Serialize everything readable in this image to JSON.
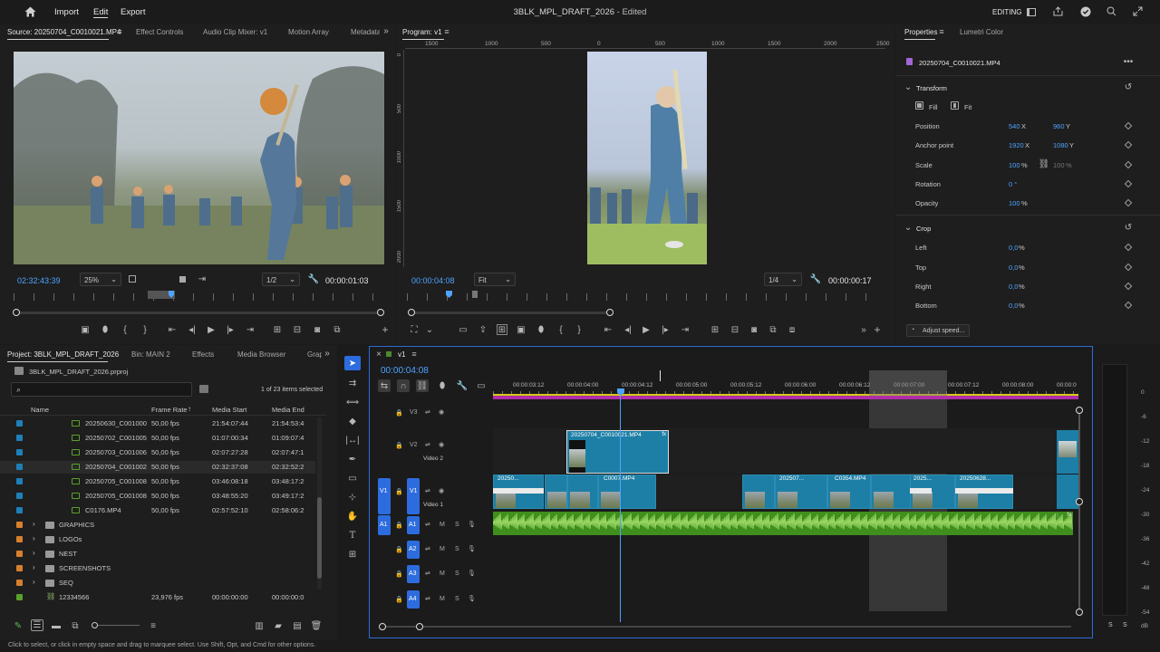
{
  "menubar": {
    "import": "Import",
    "edit": "Edit",
    "export": "Export",
    "title": "3BLK_MPL_DRAFT_2026",
    "title_suffix": "- Edited",
    "workspace": "EDITING"
  },
  "source_monitor": {
    "tabs": [
      "Source: 20250704_C0010021.MP4",
      "Effect Controls",
      "Audio Clip Mixer: v1",
      "Motion Array",
      "Metadata"
    ],
    "timecode": "02:32:43:39",
    "zoom": "25%",
    "resolution": "1/2",
    "duration": "00:00:01:03"
  },
  "program_monitor": {
    "tab": "Program: v1",
    "ruler_labels": [
      "1500",
      "1000",
      "500",
      "0",
      "500",
      "1000",
      "1500",
      "2000",
      "2500"
    ],
    "left_ruler_labels": [
      "0",
      "500",
      "1000",
      "1500",
      "2000"
    ],
    "timecode": "00:00:04:08",
    "fit": "Fit",
    "resolution": "1/4",
    "duration": "00:00:00:17"
  },
  "properties": {
    "tabs": [
      "Properties",
      "Lumetri Color"
    ],
    "clip_name": "20250704_C0010021.MP4",
    "transform_header": "Transform",
    "fill": "Fill",
    "fit": "Fit",
    "position_label": "Position",
    "position_x": "540",
    "position_y": "960",
    "anchor_label": "Anchor point",
    "anchor_x": "1920",
    "anchor_y": "1080",
    "scale_label": "Scale",
    "scale_value": "100",
    "scale_value2": "100",
    "rotation_label": "Rotation",
    "rotation_value": "0 °",
    "opacity_label": "Opacity",
    "opacity_value": "100",
    "crop_header": "Crop",
    "left_label": "Left",
    "left_value": "0,0",
    "top_label": "Top",
    "top_value": "0,0",
    "right_label": "Right",
    "right_value": "0,0",
    "bottom_label": "Bottom",
    "bottom_value": "0,0",
    "unit_x": "X",
    "unit_y": "Y",
    "unit_pct": "%",
    "adjust_speed": "Adjust speed..."
  },
  "project": {
    "tabs": [
      "Project: 3BLK_MPL_DRAFT_2026",
      "Bin: MAIN 2",
      "Effects",
      "Media Browser",
      "Grap"
    ],
    "file": "3BLK_MPL_DRAFT_2026.prproj",
    "selection": "1 of 23 items selected",
    "columns": [
      "Name",
      "Frame Rate",
      "Media Start",
      "Media End"
    ],
    "items": [
      {
        "name": "20250630_C001000",
        "rate": "50,00 fps",
        "start": "21:54:07:44",
        "end": "21:54:53:4",
        "color": "#1f7fb8"
      },
      {
        "name": "20250702_C001005",
        "rate": "50,00 fps",
        "start": "01:07:00:34",
        "end": "01:09:07:4",
        "color": "#1f7fb8"
      },
      {
        "name": "20250703_C001006",
        "rate": "50,00 fps",
        "start": "02:07:27:28",
        "end": "02:07:47:1",
        "color": "#1f7fb8"
      },
      {
        "name": "20250704_C001002",
        "rate": "50,00 fps",
        "start": "02:32:37:08",
        "end": "02:32:52:2",
        "color": "#1f7fb8"
      },
      {
        "name": "20250705_C001008",
        "rate": "50,00 fps",
        "start": "03:46:08:18",
        "end": "03:48:17:2",
        "color": "#1f7fb8"
      },
      {
        "name": "20250705_C001008",
        "rate": "50,00 fps",
        "start": "03:48:55:20",
        "end": "03:49:17:2",
        "color": "#1f7fb8"
      },
      {
        "name": "C0176.MP4",
        "rate": "50,00 fps",
        "start": "02:57:52:10",
        "end": "02:58:06:2",
        "color": "#1f7fb8"
      }
    ],
    "folders": [
      {
        "name": "GRAPHICS",
        "color": "#d6802e"
      },
      {
        "name": "LOGOs",
        "color": "#d6802e"
      },
      {
        "name": "NEST",
        "color": "#d6802e"
      },
      {
        "name": "SCREENSHOTS",
        "color": "#d6802e"
      },
      {
        "name": "SEQ",
        "color": "#d6802e"
      }
    ],
    "sequence": {
      "name": "12334566",
      "rate": "23,976 fps",
      "start": "00:00:00:00",
      "end": "00:00:00:0",
      "color": "#5aa02c"
    }
  },
  "timeline": {
    "tab": "v1",
    "timecode": "00:00:04:08",
    "ruler": [
      "00:00:03:12",
      "00:00:04:00",
      "00:00:04:12",
      "00:00:05:00",
      "00:00:05:12",
      "00:00:06:00",
      "00:00:06:12",
      "00:00:07:00",
      "00:00:07:12",
      "00:00:08:00",
      "00:00:0"
    ],
    "tracks_video": [
      {
        "id": "V3",
        "name": ""
      },
      {
        "id": "V2",
        "name": "Video 2"
      },
      {
        "id": "V1",
        "name": "Video 1"
      }
    ],
    "tracks_audio": [
      "A1",
      "A2",
      "A3",
      "A4"
    ],
    "track_m": "M",
    "track_s": "S",
    "v1_source": "V1",
    "a1_source": "A1",
    "v2_clip": "20250704_C0010021.MP4",
    "v1_clips": [
      "20250...",
      "C0007.MP4",
      "202507...",
      "C0354.MP4",
      "2025...",
      "20250628..."
    ],
    "fx": "fx"
  },
  "meter": {
    "scale": [
      "0",
      "-6",
      "-12",
      "-18",
      "-24",
      "-30",
      "-36",
      "-42",
      "-48",
      "-54"
    ],
    "db": "dB",
    "solo_left": "S",
    "solo_right": "S"
  },
  "status_bar": "Click to select, or click in empty space and drag to marquee select. Use Shift, Opt, and Cmd for other options."
}
